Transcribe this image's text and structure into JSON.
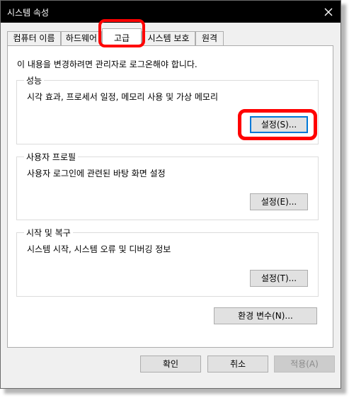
{
  "window": {
    "title": "시스템 속성"
  },
  "tabs": [
    {
      "label": "컴퓨터 이름"
    },
    {
      "label": "하드웨어"
    },
    {
      "label": "고급"
    },
    {
      "label": "시스템 보호"
    },
    {
      "label": "원격"
    }
  ],
  "active_tab": "고급",
  "notice": "이 내용을 변경하려면 관리자로 로그온해야 합니다.",
  "groups": {
    "performance": {
      "label": "성능",
      "description": "시각 효과, 프로세서 일정, 메모리 사용 및 가상 메모리",
      "button": "설정(S)..."
    },
    "user_profiles": {
      "label": "사용자 프로필",
      "description": "사용자 로그인에 관련된 바탕 화면 설정",
      "button": "설정(E)..."
    },
    "startup_recovery": {
      "label": "시작 및 복구",
      "description": "시스템 시작, 시스템 오류 및 디버깅 정보",
      "button": "설정(T)..."
    }
  },
  "env_button": "환경 변수(N)...",
  "footer": {
    "ok": "확인",
    "cancel": "취소",
    "apply": "적용(A)"
  },
  "colors": {
    "titlebar": "#000000",
    "highlight": "#ff0000",
    "focus": "#0078d7"
  },
  "icons": {
    "close": "close-icon"
  }
}
